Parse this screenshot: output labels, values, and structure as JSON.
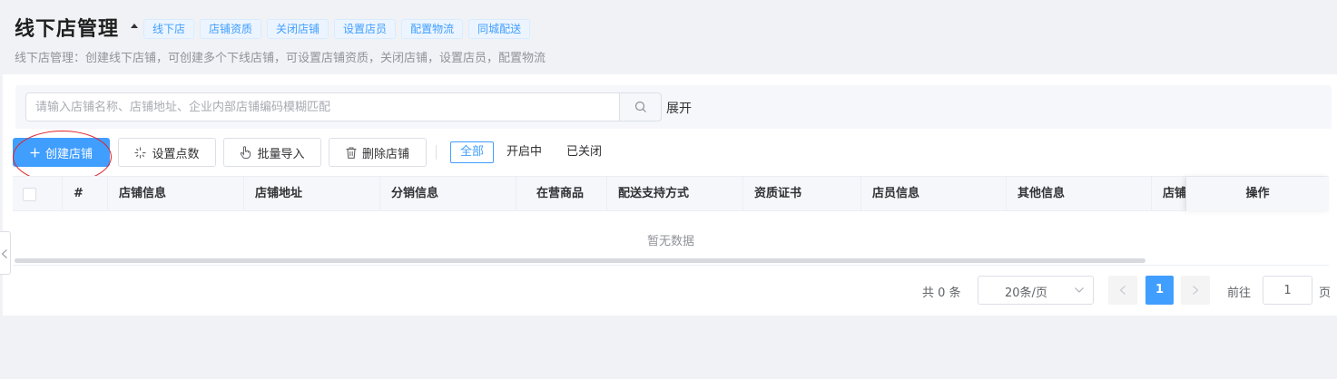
{
  "header": {
    "title": "线下店管理",
    "tags": [
      "线下店",
      "店铺资质",
      "关闭店铺",
      "设置店员",
      "配置物流",
      "同城配送"
    ],
    "description": "线下店管理：创建线下店铺，可创建多个下线店铺，可设置店铺资质，关闭店铺，设置店员，配置物流"
  },
  "search": {
    "placeholder": "请输入店铺名称、店铺地址、企业内部店铺编码模糊匹配",
    "value": "",
    "expand_label": "展开"
  },
  "toolbar": {
    "create_label": "创建店铺",
    "set_points_label": "设置点数",
    "batch_import_label": "批量导入",
    "delete_label": "删除店铺"
  },
  "filters": [
    "全部",
    "开启中",
    "已关闭"
  ],
  "table": {
    "columns": [
      "#",
      "店铺信息",
      "店铺地址",
      "分销信息",
      "在营商品",
      "配送支持方式",
      "资质证书",
      "店员信息",
      "其他信息",
      "店铺"
    ],
    "ops_label": "操作",
    "empty_text": "暂无数据"
  },
  "pagination": {
    "total_text": "共 0 条",
    "page_size": "20条/页",
    "current_page": "1",
    "goto_label": "前往",
    "goto_value": "1",
    "goto_suffix": "页"
  },
  "colors": {
    "primary": "#409eff",
    "annotation": "#e0242b"
  },
  "icons": [
    "caret-up-icon",
    "search-icon",
    "plus-icon",
    "sparkle-icon",
    "hand-pointer-icon",
    "trash-icon",
    "chevron-down-icon",
    "chevron-left-icon",
    "chevron-right-icon"
  ]
}
